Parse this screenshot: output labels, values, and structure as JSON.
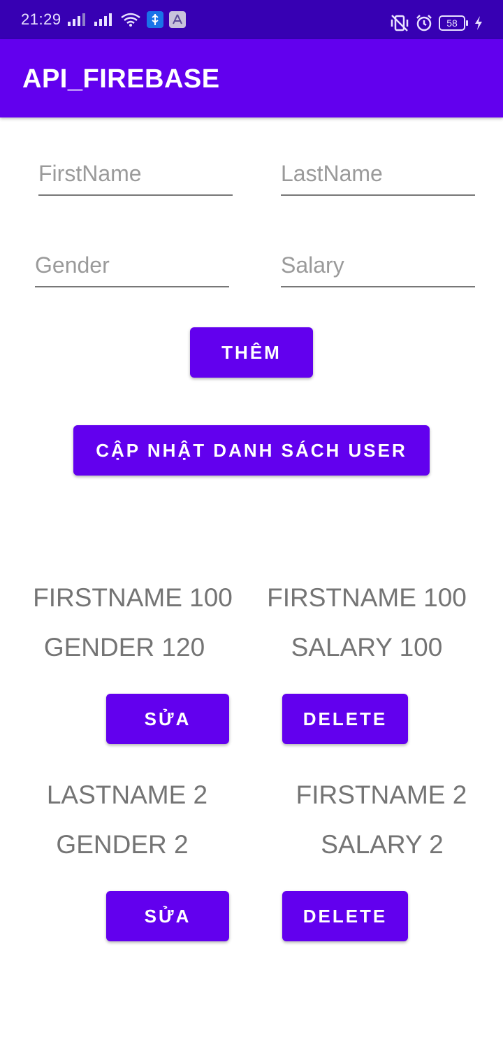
{
  "status_bar": {
    "time": "21:29",
    "battery": "58"
  },
  "app_bar": {
    "title": "API_FIREBASE"
  },
  "form": {
    "firstname_placeholder": "FirstName",
    "lastname_placeholder": "LastName",
    "gender_placeholder": "Gender",
    "salary_placeholder": "Salary",
    "add_label": "THÊM",
    "refresh_label": "CẬP NHẬT DANH SÁCH USER"
  },
  "users": [
    {
      "left_top": "FIRSTNAME 100",
      "right_top": "FIRSTNAME 100",
      "left_bottom": "GENDER 120",
      "right_bottom": "SALARY 100",
      "edit_label": "SỬA",
      "delete_label": "DELETE"
    },
    {
      "left_top": "LASTNAME 2",
      "right_top": "FIRSTNAME 2",
      "left_bottom": "GENDER 2",
      "right_bottom": "SALARY 2",
      "edit_label": "SỬA",
      "delete_label": "DELETE"
    }
  ]
}
